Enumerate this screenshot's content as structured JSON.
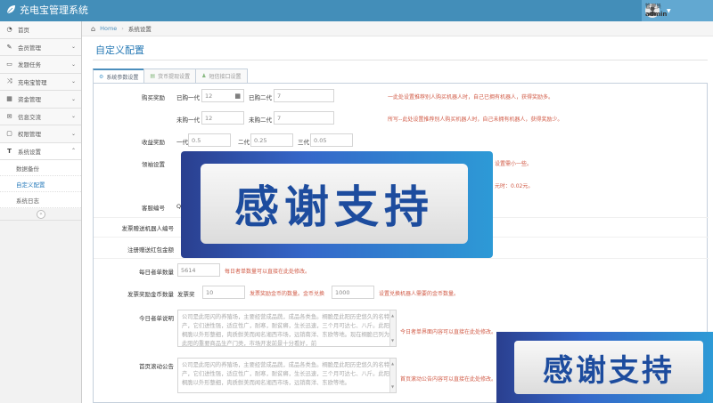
{
  "app": {
    "title": "充电宝管理系统"
  },
  "user": {
    "role": "管理员",
    "name": "admin"
  },
  "sidebar": {
    "items": [
      {
        "label": "首页",
        "icon": "dashboard-icon"
      },
      {
        "label": "会员管理",
        "icon": "edit-icon"
      },
      {
        "label": "发题任务",
        "icon": "folder-icon"
      },
      {
        "label": "充电宝管理",
        "icon": "shuffle-icon"
      },
      {
        "label": "资金管理",
        "icon": "calendar-icon"
      },
      {
        "label": "信息交流",
        "icon": "envelope-icon"
      },
      {
        "label": "权限管理",
        "icon": "file-icon"
      },
      {
        "label": "系统设置",
        "icon": "text-width-icon"
      }
    ],
    "sub": [
      "数据备份",
      "自定义配置",
      "系统日志"
    ]
  },
  "breadcrumb": {
    "home": "Home",
    "current": "系统设置"
  },
  "page": {
    "title": "自定义配置"
  },
  "tabs": [
    "系统参数设置",
    "货币提现设置",
    "短信接口设置"
  ],
  "form": {
    "buy_reward_label": "购买奖励",
    "buy_row1": {
      "l1": "已购一代",
      "v1": "12",
      "l2": "已购二代",
      "v2": "7",
      "hint": "一此处设置推荐别人购买机器人时，自己已拥有机器人，获得奖励多。"
    },
    "buy_row2": {
      "l1": "未购一代",
      "v1": "12",
      "l2": "未购二代",
      "v2": "7",
      "hint": "所写--此处设置推荐别人购买机器人时，自己未拥有机器人，获得奖励少。"
    },
    "income_label": "收益奖励",
    "income": {
      "l1": "一代",
      "v1": "0.5",
      "l2": "二代",
      "v2": "0.25",
      "l3": "三代",
      "v3": "0.05"
    },
    "collect_label": "领袖设置",
    "collect_hint1": "设置需小一些。",
    "collect_hint2": "元时：0.02元。",
    "service_label": "客服编号",
    "service_prefix": "Q",
    "send_robot_label": "发票赠送机器人编号",
    "register_label": "注册赠送红包金额",
    "daily_label": "每日者单数量",
    "daily_value": "5614",
    "daily_hint": "每日者单数量可以直接在此处修改。",
    "coin_label": "发票奖励金币数量",
    "coin_l1": "发票奖",
    "coin_v1": "10",
    "coin_hint1": "发票奖励金币的数量。金币兑换",
    "coin_v2": "1000",
    "coin_hint2": "设置兑换机器人需要的金币数量。",
    "today_label": "今日者单说明",
    "today_text": "公司是此阳闪的养殖场，主要经营成品蔬，成品各类鱼。桐脆是此阳历史悠久的名特产，它们进性强，适应性广，耐寒，耐贫瘠，生长迅速，三个月可达七、八斤。此阳桐脆以外形整细，肉质鲜美而闻名湘西市场，远销南洋、东欧等地。现在桐脆已列为此阳的重要商品生产门类，市场开发前景十分看好，前",
    "today_hint": "今日者单界面内容可以直接在此处修改。",
    "scroll_label": "首页滚动公告",
    "scroll_text": "公司是此阳闪的养殖场，主要经营成品蔬，成品各类鱼。桐脆是此阳历史悠久的名特产，它们进性强，适应性广，耐寒，耐贫瘠，生长迅速，三个月可达七、八斤。此阳桐脆以外形整细，肉质鲜美而闻名湘西市场，远销南洋、东欧等地。",
    "scroll_hint": "首页滚动公告内容可以直接在此处修改。"
  },
  "overlays": {
    "text": "感谢支持"
  },
  "colors": {
    "topbar": "#438eb9",
    "accent": "#2679b5",
    "hint": "#d15b47"
  }
}
